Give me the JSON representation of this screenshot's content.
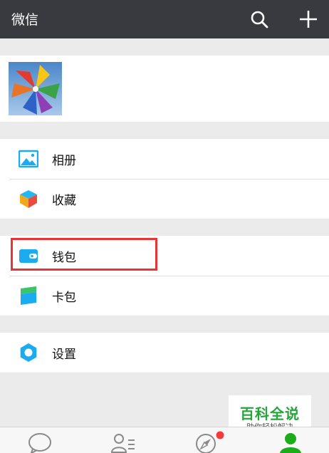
{
  "header": {
    "title": "微信",
    "search_icon": "search-icon",
    "add_icon": "plus-icon"
  },
  "profile": {
    "avatar": "pinwheel-avatar"
  },
  "menu": {
    "album": {
      "label": "相册",
      "icon": "photo-album-icon"
    },
    "favorites": {
      "label": "收藏",
      "icon": "favorites-cube-icon"
    },
    "wallet": {
      "label": "钱包",
      "icon": "wallet-icon"
    },
    "card_pack": {
      "label": "卡包",
      "icon": "card-pack-icon"
    },
    "settings": {
      "label": "设置",
      "icon": "settings-gear-icon"
    }
  },
  "watermark": {
    "title": "百科全说",
    "subtitle": "助你轻松解决"
  },
  "tabbar": {
    "tabs": [
      "chat-bubble-icon",
      "contacts-icon",
      "compass-icon",
      "me-person-icon"
    ],
    "active_tab": "me-person-icon",
    "discover_badge": "red-dot"
  },
  "colors": {
    "header_bg": "#393a3f",
    "highlight_box": "#e83434",
    "icon_blue": "#1aabf0",
    "active_tab_green": "#1aad19",
    "watermark_green": "#24a63b"
  }
}
